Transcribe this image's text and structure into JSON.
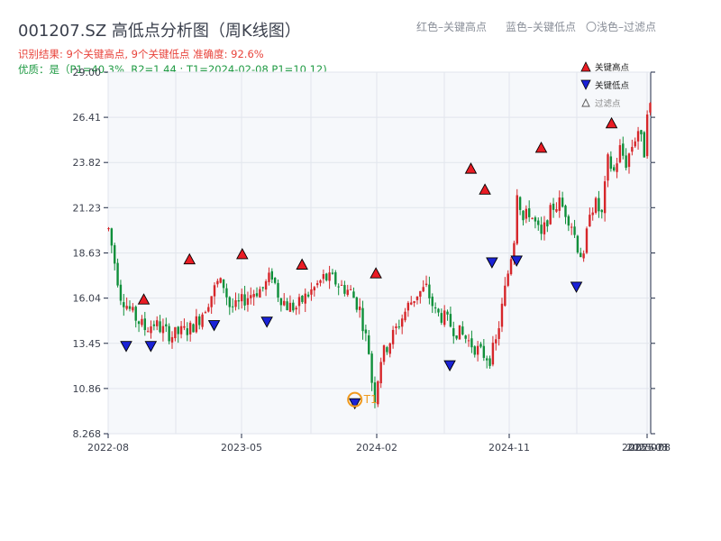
{
  "header": {
    "title": "001207.SZ 高低点分析图（周K线图）",
    "result_line": "识别结果: 9个关键高点, 9个关键低点  准确度: 92.6%",
    "quality_line": "优质：是（P1=40.3%, R2=1.44 ; T1=2024-02-08 P1=10.12)",
    "hint_red": "红色–关键高点",
    "hint_blue": "蓝色–关键低点",
    "hint_light": "〇浅色–过滤点"
  },
  "legend": {
    "high": "关键高点",
    "low": "关键低点",
    "filtered": "过滤点"
  },
  "colors": {
    "up": "#d6262a",
    "down": "#0f8f3a",
    "high_marker": "#ea1c24",
    "low_marker": "#1a22d6",
    "t1_ring": "#f09a1f",
    "plot_bg": "#f6f8fb"
  },
  "chart_data": {
    "type": "candlestick",
    "title": "001207.SZ 高低点分析图（周K线图）",
    "ylim": [
      8.268,
      29.0
    ],
    "y_ticks": [
      "8.268",
      "10.86",
      "13.45",
      "16.04",
      "18.63",
      "21.23",
      "23.82",
      "26.41",
      "29.00"
    ],
    "x_ticks": [
      "2022-08",
      "2023-05",
      "2024-02",
      "2024-11",
      "2025-08"
    ],
    "x_ticks_overlap": [
      "2025-07",
      "2025-08"
    ],
    "t1_label": "T1",
    "trend_close": [
      [
        0,
        20.0
      ],
      [
        4,
        16.2
      ],
      [
        8,
        15.1
      ],
      [
        12,
        14.3
      ],
      [
        15,
        14.6
      ],
      [
        18,
        14.2
      ],
      [
        21,
        13.9
      ],
      [
        24,
        14.1
      ],
      [
        27,
        14.3
      ],
      [
        30,
        14.9
      ],
      [
        33,
        15.9
      ],
      [
        36,
        16.9
      ],
      [
        38,
        16.8
      ],
      [
        40,
        15.6
      ],
      [
        42,
        15.5
      ],
      [
        45,
        16.0
      ],
      [
        48,
        16.4
      ],
      [
        51,
        16.6
      ],
      [
        54,
        17.4
      ],
      [
        56,
        16.3
      ],
      [
        59,
        15.6
      ],
      [
        62,
        15.5
      ],
      [
        65,
        16.1
      ],
      [
        68,
        16.6
      ],
      [
        71,
        17.2
      ],
      [
        74,
        17.1
      ],
      [
        77,
        16.7
      ],
      [
        80,
        16.4
      ],
      [
        83,
        15.4
      ],
      [
        86,
        13.0
      ],
      [
        87,
        11.3
      ],
      [
        88,
        10.4
      ],
      [
        90,
        12.6
      ],
      [
        93,
        13.6
      ],
      [
        96,
        14.6
      ],
      [
        99,
        15.6
      ],
      [
        102,
        16.3
      ],
      [
        105,
        16.6
      ],
      [
        108,
        15.2
      ],
      [
        111,
        14.9
      ],
      [
        114,
        14.3
      ],
      [
        117,
        13.9
      ],
      [
        120,
        13.4
      ],
      [
        123,
        12.9
      ],
      [
        126,
        12.6
      ],
      [
        128,
        13.5
      ],
      [
        130,
        15.5
      ],
      [
        132,
        17.5
      ],
      [
        134,
        19.5
      ],
      [
        135,
        22.3
      ],
      [
        137,
        20.5
      ],
      [
        139,
        21.0
      ],
      [
        141,
        20.3
      ],
      [
        143,
        19.5
      ],
      [
        145,
        20.6
      ],
      [
        147,
        21.3
      ],
      [
        149,
        21.5
      ],
      [
        151,
        21.0
      ],
      [
        153,
        20.3
      ],
      [
        155,
        19.0
      ],
      [
        157,
        18.2
      ],
      [
        159,
        21.2
      ],
      [
        161,
        21.4
      ],
      [
        163,
        20.8
      ],
      [
        165,
        23.9
      ],
      [
        167,
        23.3
      ],
      [
        169,
        24.6
      ],
      [
        171,
        23.8
      ],
      [
        173,
        24.8
      ],
      [
        175,
        25.7
      ],
      [
        177,
        24.4
      ],
      [
        178,
        27.0
      ]
    ],
    "key_highs": [
      {
        "i": 10,
        "price": 15.6
      },
      {
        "i": 23,
        "price": 17.9
      },
      {
        "i": 38,
        "price": 18.2
      },
      {
        "i": 55,
        "price": 17.6
      },
      {
        "i": 76,
        "price": 17.1
      },
      {
        "i": 103,
        "price": 23.1
      },
      {
        "i": 107,
        "price": 21.9
      },
      {
        "i": 123,
        "price": 24.3
      },
      {
        "i": 143,
        "price": 25.7
      }
    ],
    "key_lows": [
      {
        "i": 5,
        "price": 13.4
      },
      {
        "i": 12,
        "price": 13.4
      },
      {
        "i": 30,
        "price": 14.6
      },
      {
        "i": 45,
        "price": 14.8
      },
      {
        "i": 70,
        "price": 10.12
      },
      {
        "i": 97,
        "price": 12.3
      },
      {
        "i": 109,
        "price": 18.2
      },
      {
        "i": 116,
        "price": 18.3
      },
      {
        "i": 133,
        "price": 16.8
      }
    ],
    "t1_index": 70
  }
}
